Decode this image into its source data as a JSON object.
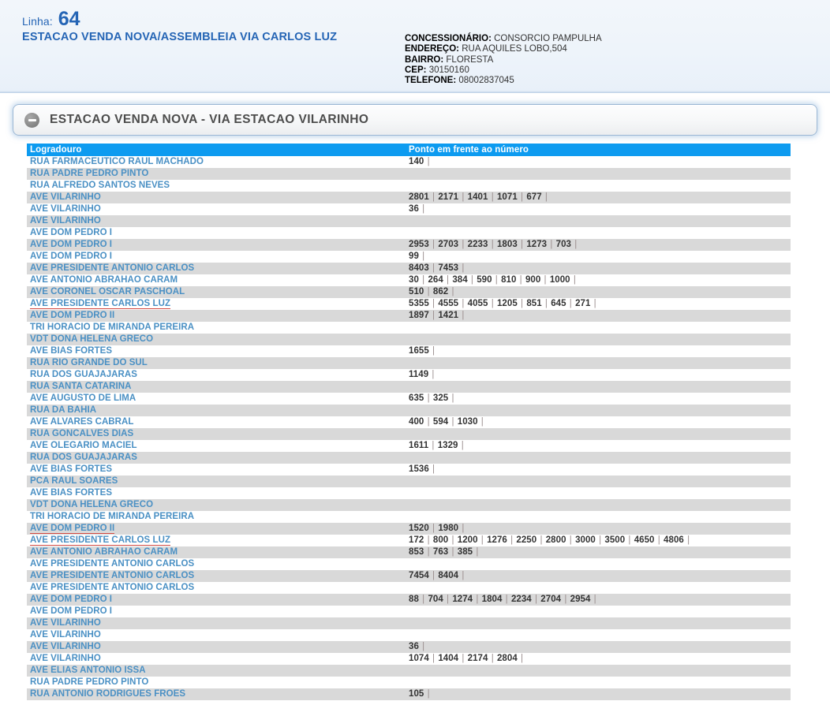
{
  "header": {
    "line_label": "Linha:",
    "line_number": "64",
    "line_name": "ESTACAO VENDA NOVA/ASSEMBLEIA VIA CARLOS LUZ",
    "concessionaire": [
      {
        "key": "CONCESSIONÁRIO:",
        "value": "CONSORCIO PAMPULHA"
      },
      {
        "key": "ENDEREÇO:",
        "value": " RUA AQUILES LOBO,504"
      },
      {
        "key": "BAIRRO:",
        "value": "FLORESTA"
      },
      {
        "key": "CEP:",
        "value": "30150160"
      },
      {
        "key": "TELEFONE:",
        "value": "08002837045"
      }
    ]
  },
  "panel": {
    "title": "ESTACAO VENDA NOVA - VIA ESTACAO VILARINHO",
    "collapse_icon": "minus-circle-icon",
    "expanded": true
  },
  "table": {
    "columns": [
      "Logradouro",
      "Ponto em frente ao número"
    ],
    "rows": [
      {
        "street": "RUA FARMACEUTICO RAUL MACHADO",
        "numbers": [
          "140"
        ],
        "misspelled": false
      },
      {
        "street": "RUA PADRE PEDRO PINTO",
        "numbers": [],
        "misspelled": false
      },
      {
        "street": "RUA ALFREDO SANTOS NEVES",
        "numbers": [],
        "misspelled": false
      },
      {
        "street": "AVE VILARINHO",
        "numbers": [
          "2801",
          "2171",
          "1401",
          "1071",
          "677"
        ],
        "misspelled": false
      },
      {
        "street": "AVE VILARINHO",
        "numbers": [
          "36"
        ],
        "misspelled": false
      },
      {
        "street": "AVE VILARINHO",
        "numbers": [],
        "misspelled": false
      },
      {
        "street": "AVE DOM PEDRO I",
        "numbers": [],
        "misspelled": false
      },
      {
        "street": "AVE DOM PEDRO I",
        "numbers": [
          "2953",
          "2703",
          "2233",
          "1803",
          "1273",
          "703"
        ],
        "misspelled": false
      },
      {
        "street": "AVE DOM PEDRO I",
        "numbers": [
          "99"
        ],
        "misspelled": false
      },
      {
        "street": "AVE PRESIDENTE ANTONIO CARLOS",
        "numbers": [
          "8403",
          "7453"
        ],
        "misspelled": false
      },
      {
        "street": "AVE ANTONIO ABRAHAO CARAM",
        "numbers": [
          "30",
          "264",
          "384",
          "590",
          "810",
          "900",
          "1000"
        ],
        "misspelled": false
      },
      {
        "street": "AVE CORONEL OSCAR PASCHOAL",
        "numbers": [
          "510",
          "862"
        ],
        "misspelled": false
      },
      {
        "street": "AVE PRESIDENTE CARLOS LUZ",
        "numbers": [
          "5355",
          "4555",
          "4055",
          "1205",
          "851",
          "645",
          "271"
        ],
        "misspelled": true
      },
      {
        "street": "AVE DOM PEDRO II",
        "numbers": [
          "1897",
          "1421"
        ],
        "misspelled": false
      },
      {
        "street": "TRI HORACIO DE MIRANDA PEREIRA",
        "numbers": [],
        "misspelled": false
      },
      {
        "street": "VDT DONA HELENA GRECO",
        "numbers": [],
        "misspelled": false
      },
      {
        "street": "AVE BIAS FORTES",
        "numbers": [
          "1655"
        ],
        "misspelled": false
      },
      {
        "street": "RUA RIO GRANDE DO SUL",
        "numbers": [],
        "misspelled": false
      },
      {
        "street": "RUA DOS GUAJAJARAS",
        "numbers": [
          "1149"
        ],
        "misspelled": false
      },
      {
        "street": "RUA SANTA CATARINA",
        "numbers": [],
        "misspelled": false
      },
      {
        "street": "AVE AUGUSTO DE LIMA",
        "numbers": [
          "635",
          "325"
        ],
        "misspelled": false
      },
      {
        "street": "RUA DA BAHIA",
        "numbers": [],
        "misspelled": false
      },
      {
        "street": "AVE ALVARES CABRAL",
        "numbers": [
          "400",
          "594",
          "1030"
        ],
        "misspelled": false
      },
      {
        "street": "RUA GONCALVES DIAS",
        "numbers": [],
        "misspelled": false
      },
      {
        "street": "AVE OLEGARIO MACIEL",
        "numbers": [
          "1611",
          "1329"
        ],
        "misspelled": false
      },
      {
        "street": "RUA DOS GUAJAJARAS",
        "numbers": [],
        "misspelled": false
      },
      {
        "street": "AVE BIAS FORTES",
        "numbers": [
          "1536"
        ],
        "misspelled": false
      },
      {
        "street": "PCA RAUL SOARES",
        "numbers": [],
        "misspelled": false
      },
      {
        "street": "AVE BIAS FORTES",
        "numbers": [],
        "misspelled": false
      },
      {
        "street": "VDT DONA HELENA GRECO",
        "numbers": [],
        "misspelled": false
      },
      {
        "street": "TRI HORACIO DE MIRANDA PEREIRA",
        "numbers": [],
        "misspelled": false
      },
      {
        "street": "AVE DOM PEDRO II",
        "numbers": [
          "1520",
          "1980"
        ],
        "misspelled": true
      },
      {
        "street": "AVE PRESIDENTE CARLOS LUZ",
        "numbers": [
          "172",
          "800",
          "1200",
          "1276",
          "2250",
          "2800",
          "3000",
          "3500",
          "4650",
          "4806"
        ],
        "misspelled": true
      },
      {
        "street": "AVE ANTONIO ABRAHAO CARAM",
        "numbers": [
          "853",
          "763",
          "385"
        ],
        "misspelled": false
      },
      {
        "street": "AVE PRESIDENTE ANTONIO CARLOS",
        "numbers": [],
        "misspelled": false
      },
      {
        "street": "AVE PRESIDENTE ANTONIO CARLOS",
        "numbers": [
          "7454",
          "8404"
        ],
        "misspelled": false
      },
      {
        "street": "AVE PRESIDENTE ANTONIO CARLOS",
        "numbers": [],
        "misspelled": false
      },
      {
        "street": "AVE DOM PEDRO I",
        "numbers": [
          "88",
          "704",
          "1274",
          "1804",
          "2234",
          "2704",
          "2954"
        ],
        "misspelled": false
      },
      {
        "street": "AVE DOM PEDRO I",
        "numbers": [],
        "misspelled": false
      },
      {
        "street": "AVE VILARINHO",
        "numbers": [],
        "misspelled": false
      },
      {
        "street": "AVE VILARINHO",
        "numbers": [],
        "misspelled": false
      },
      {
        "street": "AVE VILARINHO",
        "numbers": [
          "36"
        ],
        "misspelled": false
      },
      {
        "street": "AVE VILARINHO",
        "numbers": [
          "1074",
          "1404",
          "2174",
          "2804"
        ],
        "misspelled": false
      },
      {
        "street": "AVE ELIAS ANTONIO ISSA",
        "numbers": [],
        "misspelled": false
      },
      {
        "street": "RUA PADRE PEDRO PINTO",
        "numbers": [],
        "misspelled": false
      },
      {
        "street": "RUA ANTONIO RODRIGUES FROES",
        "numbers": [
          "105"
        ],
        "misspelled": false
      }
    ]
  },
  "colors": {
    "accent_blue": "#0d9bf0",
    "street_text": "#4a90c4",
    "title_blue": "#2565b5",
    "row_alt": "#d9d9d9",
    "misspell_underline": "#d24a43"
  }
}
